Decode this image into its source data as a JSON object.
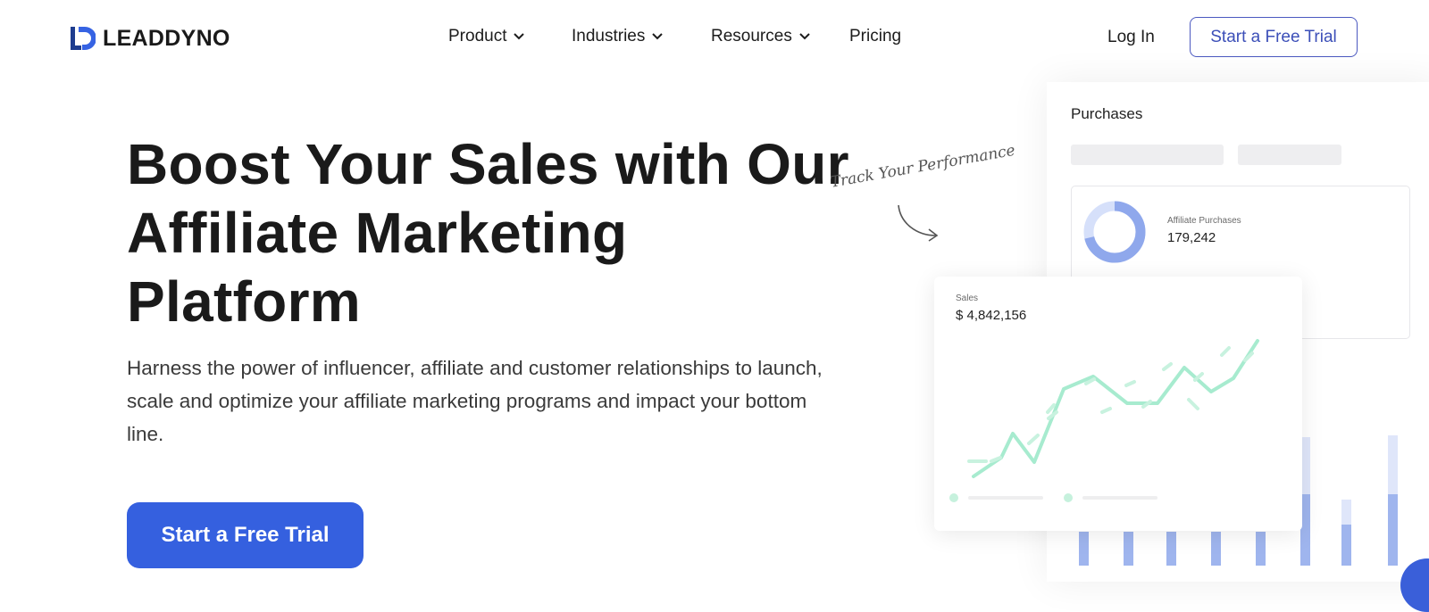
{
  "header": {
    "logo_text": "LEADDYNO",
    "nav": [
      {
        "label": "Product",
        "has_dropdown": true
      },
      {
        "label": "Industries",
        "has_dropdown": true
      },
      {
        "label": "Resources",
        "has_dropdown": true
      },
      {
        "label": "Pricing",
        "has_dropdown": false
      }
    ],
    "login_label": "Log In",
    "trial_label": "Start a Free Trial"
  },
  "hero": {
    "title": "Boost Your Sales with Our Affiliate Marketing Platform",
    "subtitle": "Harness the power of influencer, affiliate and customer relationships to launch, scale and optimize your affiliate marketing programs and impact your bottom line.",
    "cta_label": "Start a Free Trial"
  },
  "illustration": {
    "purchases_title": "Purchases",
    "annotation": "Track Your Performance",
    "affiliate_purchases": {
      "label": "Affiliate Purchases",
      "value": "179,242"
    },
    "sales": {
      "label": "Sales",
      "value": "$ 4,842,156"
    }
  },
  "colors": {
    "brand_blue": "#3560df",
    "nav_outline": "#4b59c0",
    "chart_green": "#9ae8c8",
    "bar_blue": "#9fb5ee"
  }
}
